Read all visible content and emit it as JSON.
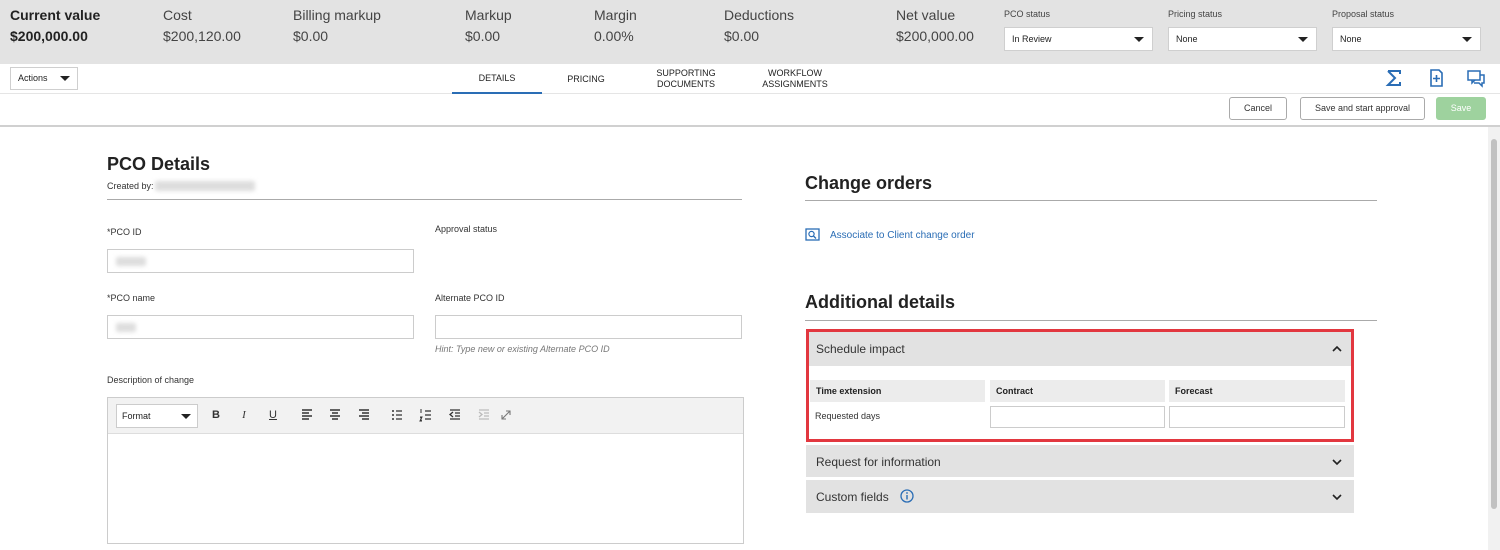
{
  "summary": {
    "metrics": [
      {
        "label": "Current value",
        "value": "$200,000.00"
      },
      {
        "label": "Cost",
        "value": "$200,120.00"
      },
      {
        "label": "Billing markup",
        "value": "$0.00"
      },
      {
        "label": "Markup",
        "value": "$0.00"
      },
      {
        "label": "Margin",
        "value": "0.00%"
      },
      {
        "label": "Deductions",
        "value": "$0.00"
      },
      {
        "label": "Net value",
        "value": "$200,000.00"
      }
    ],
    "statuses": [
      {
        "label": "PCO status",
        "value": "In Review"
      },
      {
        "label": "Pricing status",
        "value": "None"
      },
      {
        "label": "Proposal status",
        "value": "None"
      }
    ]
  },
  "tabbar": {
    "actions_label": "Actions",
    "tabs": [
      {
        "label": "DETAILS"
      },
      {
        "label": "PRICING"
      },
      {
        "label": "SUPPORTING DOCUMENTS"
      },
      {
        "label": "WORKFLOW ASSIGNMENTS"
      }
    ],
    "icons": [
      "sigma-icon",
      "add-document-icon",
      "comments-icon"
    ]
  },
  "actionbar": {
    "cancel": "Cancel",
    "save_and_start": "Save and start approval",
    "save": "Save"
  },
  "pco": {
    "title": "PCO Details",
    "created_by": "Created by:",
    "pco_id_label": "*PCO ID",
    "approval_status_label": "Approval status",
    "pco_name_label": "*PCO name",
    "alternate_label": "Alternate PCO ID",
    "alternate_hint": "Hint: Type new or existing Alternate PCO ID",
    "description_label": "Description of change",
    "format_label": "Format"
  },
  "change_orders": {
    "title": "Change orders",
    "associate_link": "Associate to Client change order"
  },
  "additional": {
    "title": "Additional details",
    "schedule_impact": {
      "title": "Schedule impact",
      "col_time_extension": "Time extension",
      "col_contract": "Contract",
      "col_forecast": "Forecast",
      "row_label": "Requested days",
      "contract_value": "",
      "forecast_value": ""
    },
    "request_info": "Request for information",
    "custom_fields": "Custom fields"
  },
  "colors": {
    "accent": "#2a6db5",
    "highlight": "#e2373f",
    "save_disabled": "#9ed29e"
  }
}
